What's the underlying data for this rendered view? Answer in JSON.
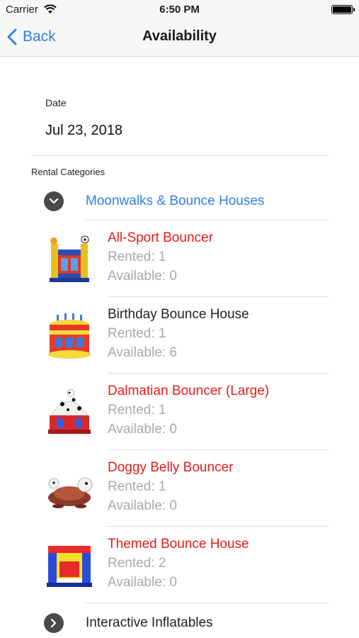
{
  "status_bar": {
    "carrier": "Carrier",
    "time": "6:50 PM"
  },
  "nav": {
    "back_label": "Back",
    "title": "Availability"
  },
  "date": {
    "label": "Date",
    "value": "Jul 23, 2018"
  },
  "rental_categories_label": "Rental Categories",
  "categories": [
    {
      "label": "Moonwalks & Bounce Houses",
      "expanded": true,
      "items": [
        {
          "name": "All-Sport Bouncer",
          "rented": "Rented: 1",
          "available": "Available: 0",
          "unavailable": true
        },
        {
          "name": "Birthday Bounce House",
          "rented": "Rented: 1",
          "available": "Available: 6",
          "unavailable": false
        },
        {
          "name": "Dalmatian Bouncer (Large)",
          "rented": "Rented: 1",
          "available": "Available: 0",
          "unavailable": true
        },
        {
          "name": "Doggy Belly Bouncer",
          "rented": "Rented: 1",
          "available": "Available: 0",
          "unavailable": true
        },
        {
          "name": "Themed Bounce House",
          "rented": "Rented: 2",
          "available": "Available: 0",
          "unavailable": true
        }
      ]
    },
    {
      "label": "Interactive Inflatables",
      "expanded": false
    }
  ],
  "colors": {
    "accent": "#2f7fe8",
    "unavailable": "#e81a1a",
    "muted": "#a9a9a9"
  }
}
